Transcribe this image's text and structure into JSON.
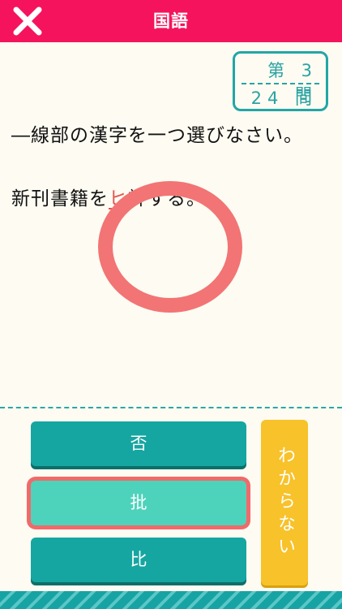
{
  "header": {
    "title": "国語",
    "close_icon": "close-icon",
    "accent_color": "#f5135d"
  },
  "counter": {
    "current": "第 3 問",
    "total": "24 問"
  },
  "question": {
    "prompt": "―線部の漢字を一つ選びなさい。",
    "sentence_before": "新刊書籍を",
    "sentence_target": "ヒ",
    "sentence_after": "評する。"
  },
  "choices": [
    {
      "label": "否",
      "selected": false
    },
    {
      "label": "批",
      "selected": true
    },
    {
      "label": "比",
      "selected": false
    }
  ],
  "dont_know_label": "わからない",
  "result_mark": "correct-circle"
}
